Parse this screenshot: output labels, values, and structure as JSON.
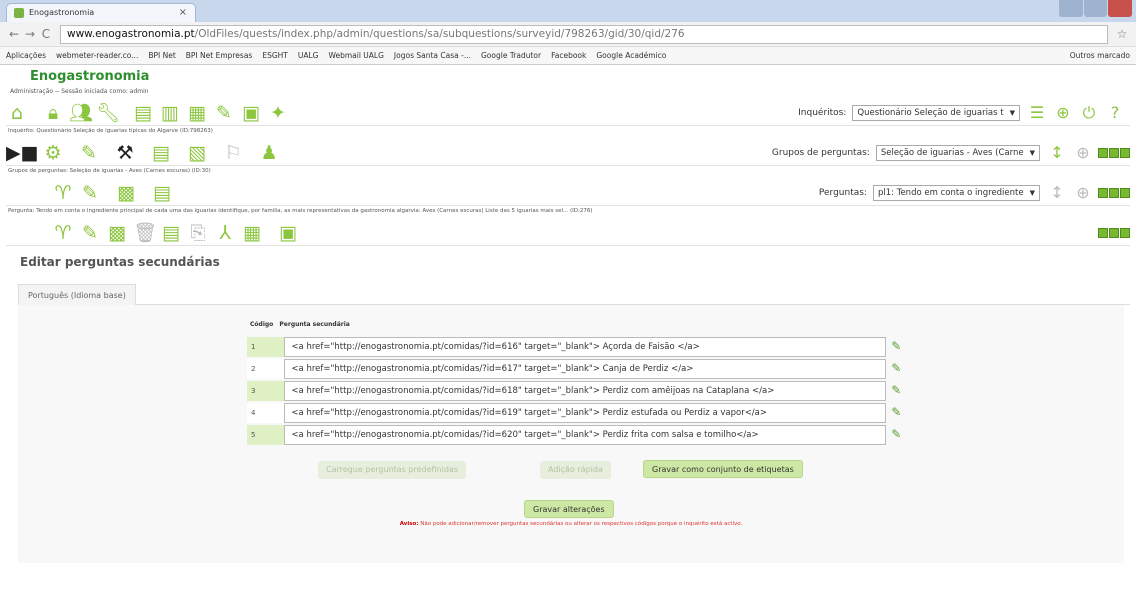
{
  "browser": {
    "tab_title": "Enogastronomia",
    "url_host": "www.enogastronomia.pt",
    "url_path": "/OldFiles/quests/index.php/admin/questions/sa/subquestions/surveyid/798263/gid/30/qid/276",
    "bookmarks": [
      "Aplicações",
      "webmeter-reader.co...",
      "BPI Net",
      "BPI Net Empresas",
      "ESGHT",
      "UALG",
      "Webmail UALG",
      "Jogos Santa Casa -...",
      "Google Tradutor",
      "Facebook",
      "Google Académico"
    ],
    "bookmarks_other": "Outros marcado"
  },
  "app": {
    "brand": "Enogastronomia",
    "admin_crumb": "Administração -- Sessão iniciada como: admin",
    "survey_crumb": "Inquérito: Questionário Seleção de iguarias típicas do Algarve (ID:798263)",
    "group_crumb": "Grupos de perguntas: Seleção de iguarias - Aves (Carnes escuras) (ID:30)",
    "question_crumb": "Pergunta: Tendo em conta o ingrediente principal de cada uma das iguarias identifique, por família, as mais representativas da gastronomia algarvia: Aves (Carnes escuras) Liste das 5 iguarias mais sel... (ID:276)",
    "surveys_label": "Inquéritos:",
    "surveys_value": "Questionário Seleção de iguarias t",
    "groups_label": "Grupos de perguntas:",
    "groups_value": "Seleção de iguarias - Aves (Carne",
    "questions_label": "Perguntas:",
    "questions_value": "pl1: Tendo em conta o ingrediente"
  },
  "editor": {
    "section_title": "Editar perguntas secundárias",
    "language_tab": "Português (Idioma base)",
    "col_code": "Código",
    "col_sub": "Pergunta secundária",
    "rows": [
      {
        "code": "1",
        "text": "<a href=\"http://enogastronomia.pt/comidas/?id=616\" target=\"_blank\"> Açorda de Faisão </a>"
      },
      {
        "code": "2",
        "text": "<a href=\"http://enogastronomia.pt/comidas/?id=617\" target=\"_blank\"> Canja de Perdiz </a>"
      },
      {
        "code": "3",
        "text": "<a href=\"http://enogastronomia.pt/comidas/?id=618\" target=\"_blank\"> Perdiz com amêijoas na Cataplana </a>"
      },
      {
        "code": "4",
        "text": "<a href=\"http://enogastronomia.pt/comidas/?id=619\" target=\"_blank\"> Perdiz estufada ou Perdiz a vapor</a>"
      },
      {
        "code": "5",
        "text": "<a href=\"http://enogastronomia.pt/comidas/?id=620\" target=\"_blank\"> Perdiz frita com salsa e tomilho</a>"
      }
    ],
    "btn_predefined": "Carregue perguntas predefinidas",
    "btn_quick_add": "Adição rápida",
    "btn_save_labelset": "Gravar como conjunto de etiquetas",
    "btn_save": "Gravar alterações",
    "warning_bold": "Aviso:",
    "warning_text": " Não pode adicionar/remover perguntas secundárias ou alterar os respectivos códigos porque o inquérito está activo."
  }
}
